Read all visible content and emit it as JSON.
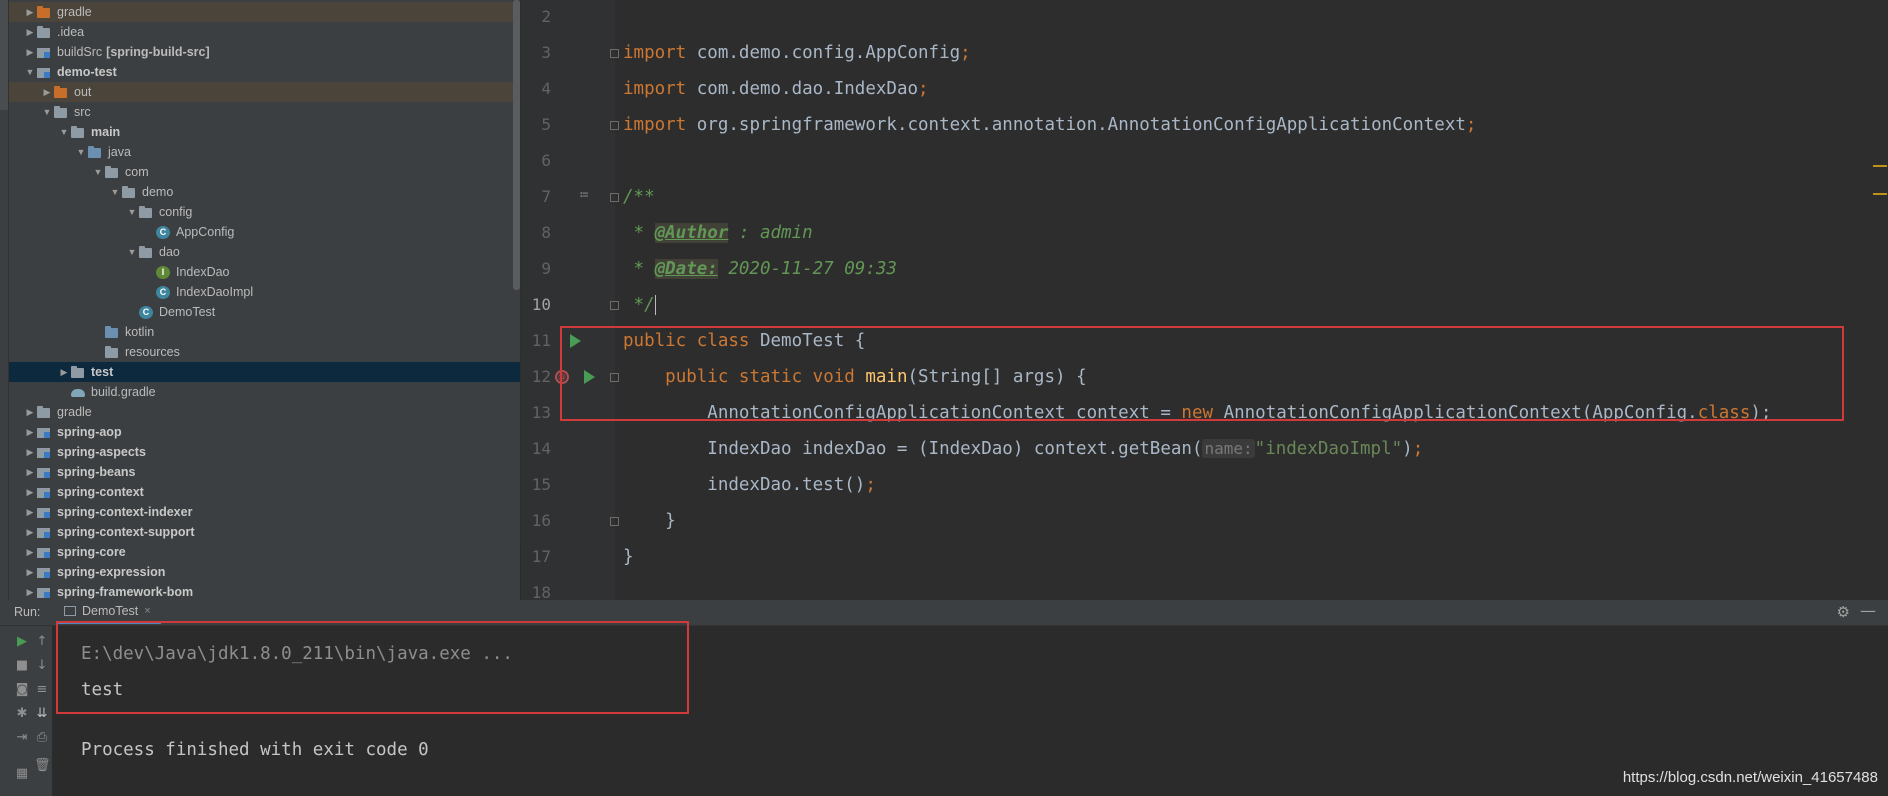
{
  "project_tree": {
    "items": [
      {
        "label": "gradle",
        "depth": 0,
        "arrow": "right",
        "icon": "folder-orange-icon",
        "excluded": true,
        "bold": false,
        "selected": false
      },
      {
        "label": ".idea",
        "depth": 0,
        "arrow": "right",
        "icon": "folder-icon",
        "excluded": false,
        "bold": false,
        "selected": false
      },
      {
        "label": "buildSrc",
        "extra": "[spring-build-src]",
        "depth": 0,
        "arrow": "right",
        "icon": "module-icon",
        "excluded": false,
        "bold": false,
        "selected": false
      },
      {
        "label": "demo-test",
        "depth": 0,
        "arrow": "down",
        "icon": "module-icon",
        "excluded": false,
        "bold": true,
        "selected": false
      },
      {
        "label": "out",
        "depth": 1,
        "arrow": "right",
        "icon": "folder-orange-icon",
        "excluded": true,
        "bold": false,
        "selected": false
      },
      {
        "label": "src",
        "depth": 1,
        "arrow": "down",
        "icon": "folder-icon",
        "excluded": false,
        "bold": false,
        "selected": false
      },
      {
        "label": "main",
        "depth": 2,
        "arrow": "down",
        "icon": "folder-icon",
        "excluded": false,
        "bold": true,
        "selected": false
      },
      {
        "label": "java",
        "depth": 3,
        "arrow": "down",
        "icon": "folder-blue-icon",
        "excluded": false,
        "bold": false,
        "selected": false
      },
      {
        "label": "com",
        "depth": 4,
        "arrow": "down",
        "icon": "folder-icon",
        "excluded": false,
        "bold": false,
        "selected": false
      },
      {
        "label": "demo",
        "depth": 5,
        "arrow": "down",
        "icon": "folder-icon",
        "excluded": false,
        "bold": false,
        "selected": false
      },
      {
        "label": "config",
        "depth": 6,
        "arrow": "down",
        "icon": "folder-icon",
        "excluded": false,
        "bold": false,
        "selected": false
      },
      {
        "label": "AppConfig",
        "depth": 7,
        "arrow": "none",
        "icon": "class-icon",
        "excluded": false,
        "bold": false,
        "selected": false
      },
      {
        "label": "dao",
        "depth": 6,
        "arrow": "down",
        "icon": "folder-icon",
        "excluded": false,
        "bold": false,
        "selected": false
      },
      {
        "label": "IndexDao",
        "depth": 7,
        "arrow": "none",
        "icon": "interface-icon",
        "excluded": false,
        "bold": false,
        "selected": false
      },
      {
        "label": "IndexDaoImpl",
        "depth": 7,
        "arrow": "none",
        "icon": "class-icon",
        "excluded": false,
        "bold": false,
        "selected": false
      },
      {
        "label": "DemoTest",
        "depth": 6,
        "arrow": "none",
        "icon": "class-icon",
        "excluded": false,
        "bold": false,
        "selected": false
      },
      {
        "label": "kotlin",
        "depth": 4,
        "arrow": "none",
        "icon": "folder-blue-icon",
        "excluded": false,
        "bold": false,
        "selected": false
      },
      {
        "label": "resources",
        "depth": 4,
        "arrow": "none",
        "icon": "folder-icon",
        "excluded": false,
        "bold": false,
        "selected": false
      },
      {
        "label": "test",
        "depth": 2,
        "arrow": "right",
        "icon": "folder-icon",
        "excluded": false,
        "bold": true,
        "selected": true
      },
      {
        "label": "build.gradle",
        "depth": 2,
        "arrow": "none",
        "icon": "gradle-icon",
        "excluded": false,
        "bold": false,
        "selected": false
      },
      {
        "label": "gradle",
        "depth": 0,
        "arrow": "right",
        "icon": "folder-icon",
        "excluded": false,
        "bold": false,
        "selected": false
      },
      {
        "label": "spring-aop",
        "depth": 0,
        "arrow": "right",
        "icon": "module-icon",
        "excluded": false,
        "bold": true,
        "selected": false
      },
      {
        "label": "spring-aspects",
        "depth": 0,
        "arrow": "right",
        "icon": "module-icon",
        "excluded": false,
        "bold": true,
        "selected": false
      },
      {
        "label": "spring-beans",
        "depth": 0,
        "arrow": "right",
        "icon": "module-icon",
        "excluded": false,
        "bold": true,
        "selected": false
      },
      {
        "label": "spring-context",
        "depth": 0,
        "arrow": "right",
        "icon": "module-icon",
        "excluded": false,
        "bold": true,
        "selected": false
      },
      {
        "label": "spring-context-indexer",
        "depth": 0,
        "arrow": "right",
        "icon": "module-icon",
        "excluded": false,
        "bold": true,
        "selected": false
      },
      {
        "label": "spring-context-support",
        "depth": 0,
        "arrow": "right",
        "icon": "module-icon",
        "excluded": false,
        "bold": true,
        "selected": false
      },
      {
        "label": "spring-core",
        "depth": 0,
        "arrow": "right",
        "icon": "module-icon",
        "excluded": false,
        "bold": true,
        "selected": false
      },
      {
        "label": "spring-expression",
        "depth": 0,
        "arrow": "right",
        "icon": "module-icon",
        "excluded": false,
        "bold": true,
        "selected": false
      },
      {
        "label": "spring-framework-bom",
        "depth": 0,
        "arrow": "right",
        "icon": "module-icon",
        "excluded": false,
        "bold": true,
        "selected": false
      }
    ]
  },
  "editor": {
    "current_line": 10,
    "lines": [
      {
        "n": 2,
        "tokens": []
      },
      {
        "n": 3,
        "tokens": [
          {
            "t": "import ",
            "c": "kw"
          },
          {
            "t": "com.demo.config.AppConfig"
          },
          {
            "t": ";",
            "c": "kw"
          }
        ]
      },
      {
        "n": 4,
        "tokens": [
          {
            "t": "import ",
            "c": "kw"
          },
          {
            "t": "com.demo.dao.IndexDao"
          },
          {
            "t": ";",
            "c": "kw"
          }
        ]
      },
      {
        "n": 5,
        "tokens": [
          {
            "t": "import ",
            "c": "kw"
          },
          {
            "t": "org.springframework.context.annotation.AnnotationConfigApplicationContext"
          },
          {
            "t": ";",
            "c": "kw"
          }
        ]
      },
      {
        "n": 6,
        "tokens": []
      },
      {
        "n": 7,
        "tokens": [
          {
            "t": "/**",
            "c": "cm"
          }
        ]
      },
      {
        "n": 8,
        "tokens": [
          {
            "t": " * ",
            "c": "cm"
          },
          {
            "t": "@Author",
            "c": "tag"
          },
          {
            "t": " : admin",
            "c": "cm"
          }
        ]
      },
      {
        "n": 9,
        "tokens": [
          {
            "t": " * ",
            "c": "cm"
          },
          {
            "t": "@Date:",
            "c": "tag"
          },
          {
            "t": " 2020-11-27 09:33",
            "c": "cm"
          }
        ]
      },
      {
        "n": 10,
        "tokens": [
          {
            "t": " */",
            "c": "cm"
          },
          {
            "t": "",
            "c": "caret"
          }
        ]
      },
      {
        "n": 11,
        "tokens": [
          {
            "t": "public class ",
            "c": "kw"
          },
          {
            "t": "DemoTest {"
          }
        ]
      },
      {
        "n": 12,
        "tokens": [
          {
            "t": "    "
          },
          {
            "t": "public static void ",
            "c": "kw"
          },
          {
            "t": "main",
            "c": "fn"
          },
          {
            "t": "(String[] args) {"
          }
        ]
      },
      {
        "n": 13,
        "tokens": [
          {
            "t": "        AnnotationConfigApplicationContext context = "
          },
          {
            "t": "new ",
            "c": "kw"
          },
          {
            "t": "AnnotationConfigApplicationContext(AppConfig."
          },
          {
            "t": "class",
            "c": "kw"
          },
          {
            "t": ");"
          }
        ]
      },
      {
        "n": 14,
        "tokens": [
          {
            "t": "        IndexDao indexDao = (IndexDao) context.getBean("
          },
          {
            "t": "name:",
            "c": "hint"
          },
          {
            "t": "\"indexDaoImpl\"",
            "c": "str"
          },
          {
            "t": ")"
          },
          {
            "t": ";",
            "c": "kw"
          }
        ]
      },
      {
        "n": 15,
        "tokens": [
          {
            "t": "        indexDao.test()"
          },
          {
            "t": ";",
            "c": "kw"
          }
        ]
      },
      {
        "n": 16,
        "tokens": [
          {
            "t": "    }"
          }
        ]
      },
      {
        "n": 17,
        "tokens": [
          {
            "t": "}"
          }
        ]
      },
      {
        "n": 18,
        "tokens": []
      }
    ]
  },
  "run_panel": {
    "label": "Run:",
    "tab_label": "DemoTest",
    "tab_close": "×",
    "console": {
      "command": "E:\\dev\\Java\\jdk1.8.0_211\\bin\\java.exe ...",
      "output": "test",
      "exit_message": "Process finished with exit code 0"
    }
  },
  "watermark": "https://blog.csdn.net/weixin_41657488",
  "colors": {
    "keyword": "#cc7832",
    "comment": "#629755",
    "string": "#6a8759",
    "method": "#ffc66d",
    "highlight_box": "#d03a3a",
    "selection": "#0d293e"
  }
}
